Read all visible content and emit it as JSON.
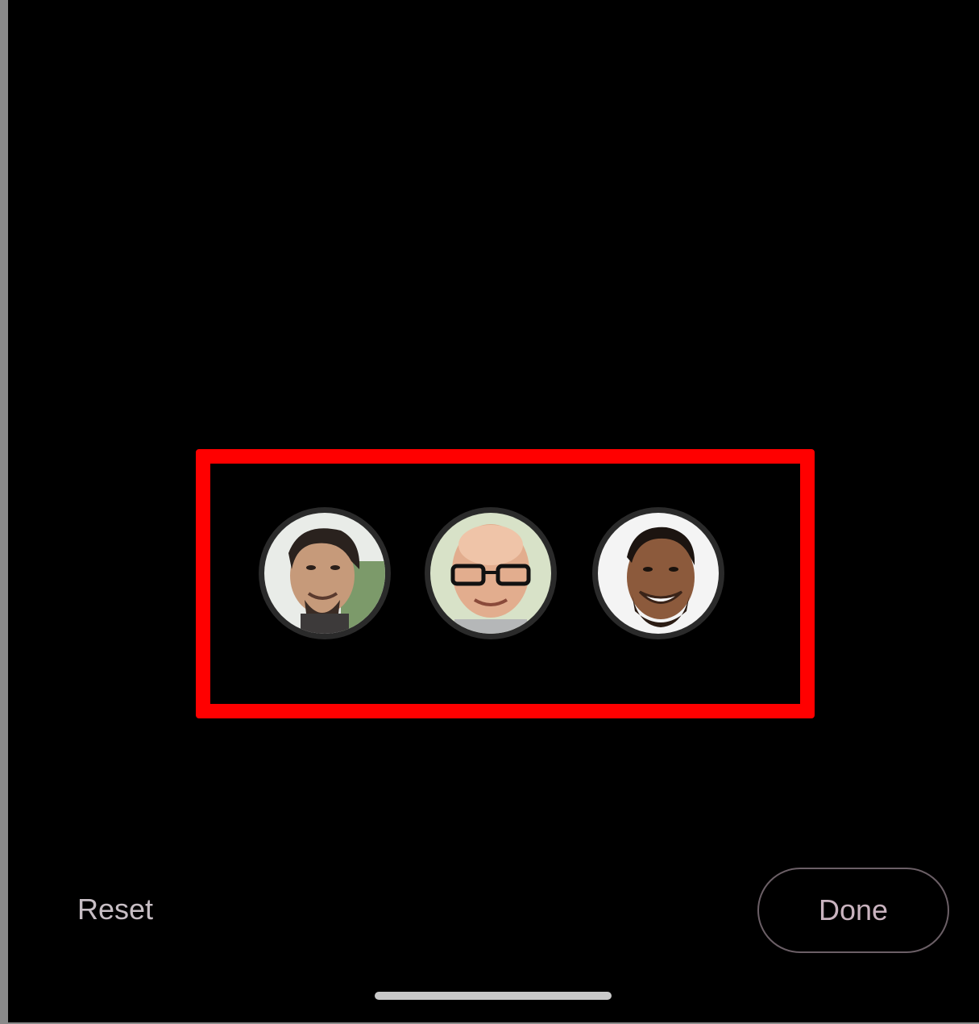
{
  "actions": {
    "reset_label": "Reset",
    "done_label": "Done"
  },
  "avatars": [
    {
      "icon": "person-photo-1"
    },
    {
      "icon": "person-photo-2"
    },
    {
      "icon": "person-photo-3"
    }
  ],
  "colors": {
    "background": "#000000",
    "highlight": "#ff0000",
    "button_text": "#c9b3bf",
    "home_indicator": "#c9c9c9"
  }
}
